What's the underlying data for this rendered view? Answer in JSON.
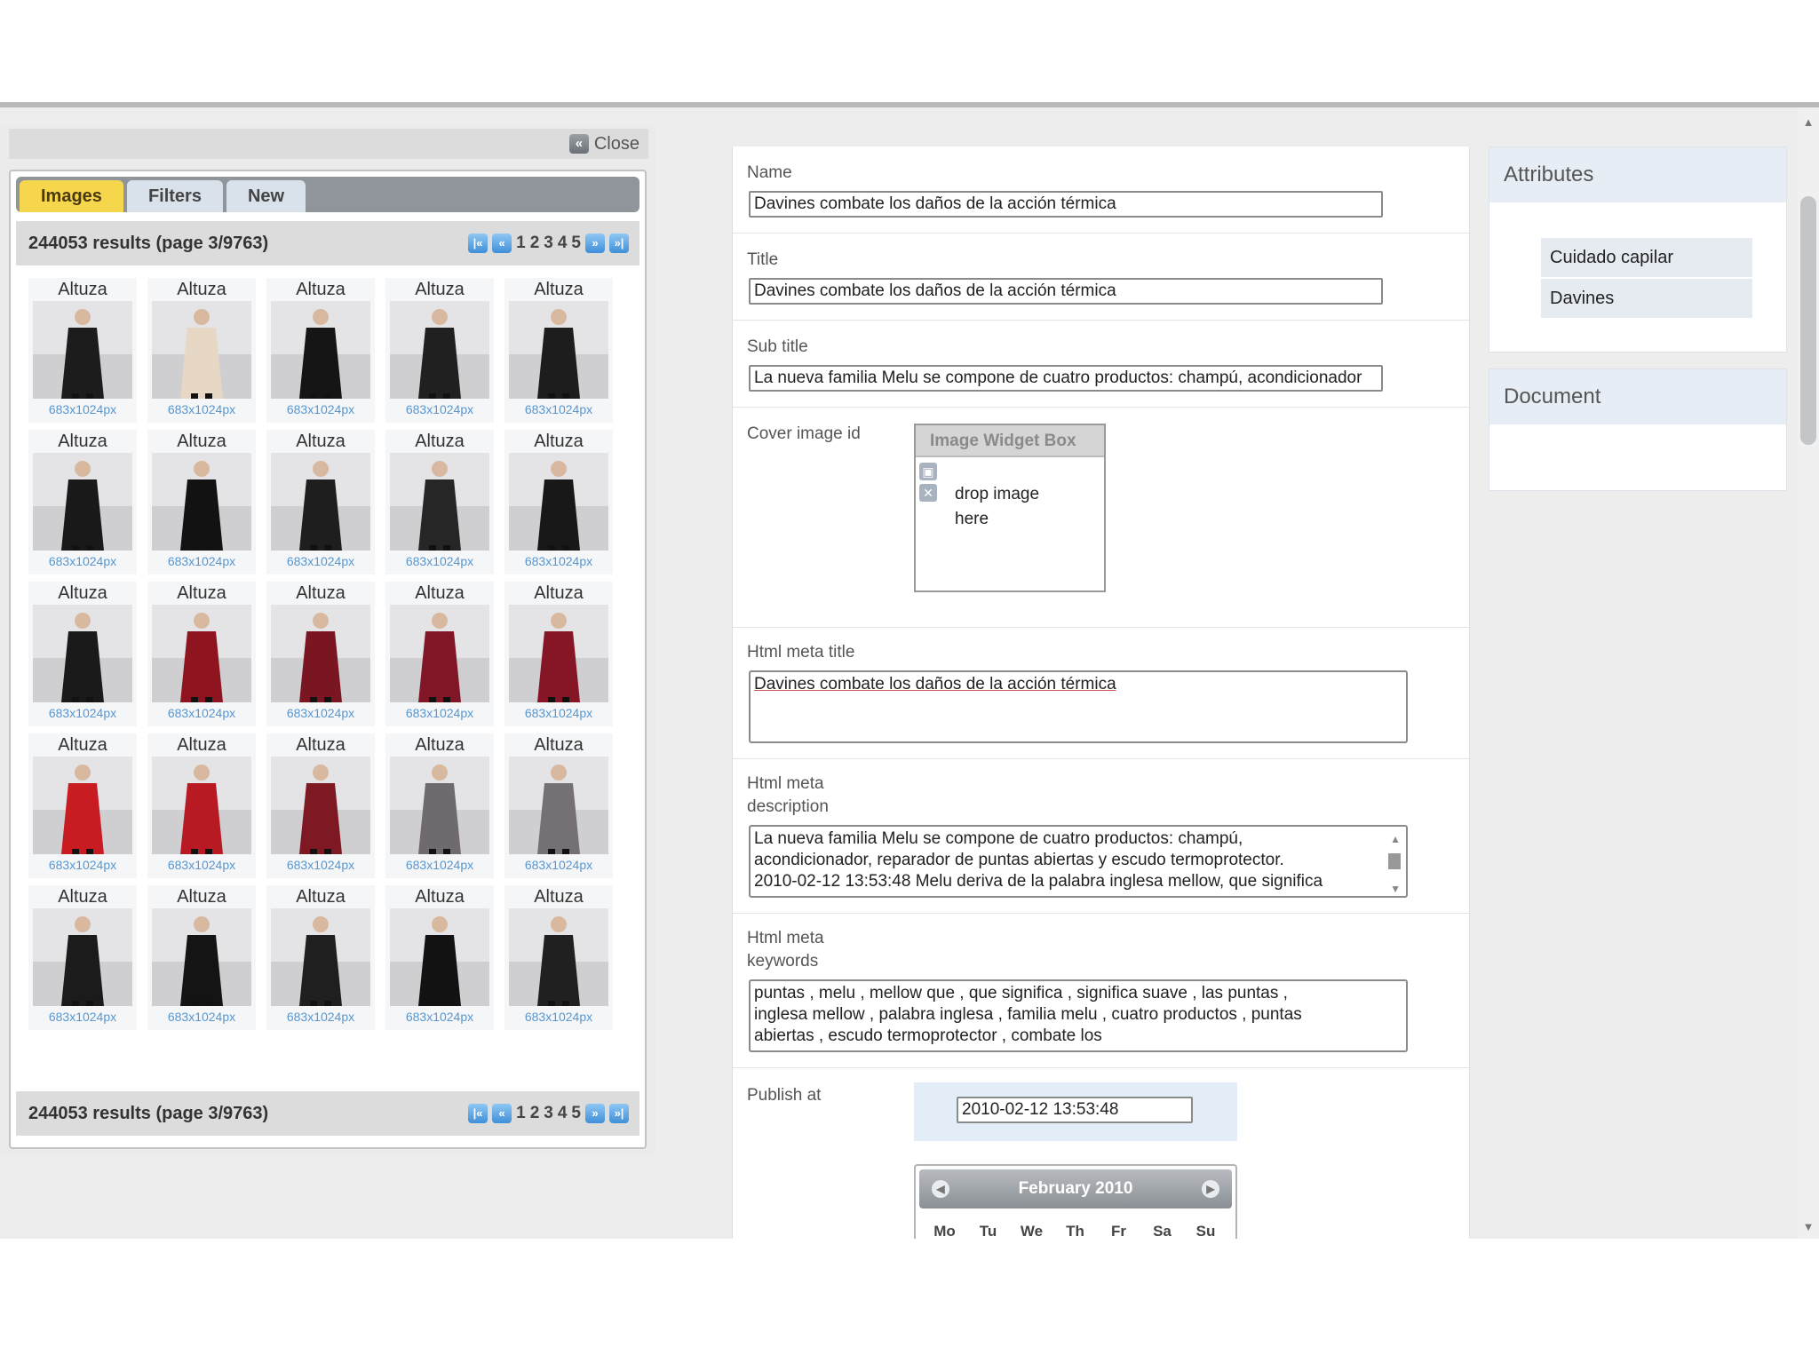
{
  "browser": {
    "close_label": "Close",
    "tabs": [
      {
        "label": "Images",
        "active": true
      },
      {
        "label": "Filters",
        "active": false
      },
      {
        "label": "New",
        "active": false
      }
    ],
    "results_text": "244053 results (page 3/9763)",
    "pager_pages": [
      "1",
      "2",
      "3",
      "4",
      "5"
    ],
    "thumbnails": [
      {
        "title": "Altuza",
        "size": "683x1024px",
        "outfit": "#1c1c1c"
      },
      {
        "title": "Altuza",
        "size": "683x1024px",
        "outfit": "#e6d8c4"
      },
      {
        "title": "Altuza",
        "size": "683x1024px",
        "outfit": "#151515"
      },
      {
        "title": "Altuza",
        "size": "683x1024px",
        "outfit": "#202020"
      },
      {
        "title": "Altuza",
        "size": "683x1024px",
        "outfit": "#1d1d1d"
      },
      {
        "title": "Altuza",
        "size": "683x1024px",
        "outfit": "#191919"
      },
      {
        "title": "Altuza",
        "size": "683x1024px",
        "outfit": "#121212"
      },
      {
        "title": "Altuza",
        "size": "683x1024px",
        "outfit": "#1e1e1e"
      },
      {
        "title": "Altuza",
        "size": "683x1024px",
        "outfit": "#262626"
      },
      {
        "title": "Altuza",
        "size": "683x1024px",
        "outfit": "#181818"
      },
      {
        "title": "Altuza",
        "size": "683x1024px",
        "outfit": "#1a1a1a"
      },
      {
        "title": "Altuza",
        "size": "683x1024px",
        "outfit": "#8e1520"
      },
      {
        "title": "Altuza",
        "size": "683x1024px",
        "outfit": "#7a1522"
      },
      {
        "title": "Altuza",
        "size": "683x1024px",
        "outfit": "#801626"
      },
      {
        "title": "Altuza",
        "size": "683x1024px",
        "outfit": "#861626"
      },
      {
        "title": "Altuza",
        "size": "683x1024px",
        "outfit": "#c81b22"
      },
      {
        "title": "Altuza",
        "size": "683x1024px",
        "outfit": "#b81a24"
      },
      {
        "title": "Altuza",
        "size": "683x1024px",
        "outfit": "#7e1823"
      },
      {
        "title": "Altuza",
        "size": "683x1024px",
        "outfit": "#6e6a6e"
      },
      {
        "title": "Altuza",
        "size": "683x1024px",
        "outfit": "#757075"
      },
      {
        "title": "Altuza",
        "size": "683x1024px",
        "outfit": "#1b1b1b"
      },
      {
        "title": "Altuza",
        "size": "683x1024px",
        "outfit": "#141414"
      },
      {
        "title": "Altuza",
        "size": "683x1024px",
        "outfit": "#1f1f1f"
      },
      {
        "title": "Altuza",
        "size": "683x1024px",
        "outfit": "#121212"
      },
      {
        "title": "Altuza",
        "size": "683x1024px",
        "outfit": "#202020"
      }
    ]
  },
  "form": {
    "name": {
      "label": "Name",
      "value": "Davines combate los daños de la acción térmica"
    },
    "title": {
      "label": "Title",
      "value": "Davines combate los daños de la acción térmica"
    },
    "subtitle": {
      "label": "Sub title",
      "value": "La nueva familia Melu se compone de cuatro productos: champú, acondicionador"
    },
    "cover": {
      "label": "Cover image id",
      "widget_title": "Image Widget Box",
      "drop_text_1": "drop image",
      "drop_text_2": "here"
    },
    "meta_title": {
      "label": "Html meta title",
      "value": "Davines combate los daños de la acción térmica"
    },
    "meta_description": {
      "label_1": "Html meta",
      "label_2": "description",
      "lines": [
        "La nueva familia Melu se compone de cuatro productos: champú,",
        "acondicionador, reparador de puntas abiertas y escudo termoprotector.",
        "2010-02-12 13:53:48 Melu deriva de la palabra inglesa mellow, que significa"
      ]
    },
    "meta_keywords": {
      "label_1": "Html meta",
      "label_2": "keywords",
      "lines": [
        "puntas , melu , mellow que , que significa , significa suave , las puntas ,",
        "inglesa mellow , palabra inglesa , familia melu , cuatro productos , puntas",
        "abiertas , escudo termoprotector , combate los"
      ]
    },
    "publish": {
      "label": "Publish at",
      "value": "2010-02-12 13:53:48",
      "calendar_month": "February 2010",
      "weekdays": [
        "Mo",
        "Tu",
        "We",
        "Th",
        "Fr",
        "Sa",
        "Su"
      ]
    }
  },
  "sidebar": {
    "attributes_title": "Attributes",
    "attributes": [
      "Cuidado capilar",
      "Davines"
    ],
    "document_title": "Document"
  }
}
